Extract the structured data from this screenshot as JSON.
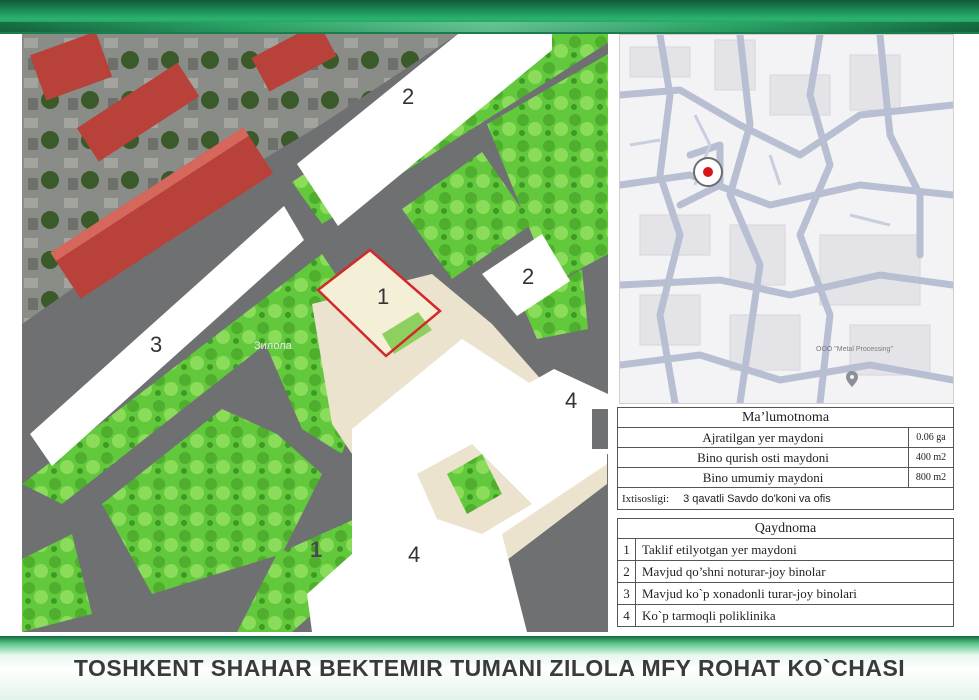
{
  "footer": {
    "title": "TOSHKENT SHAHAR BEKTEMIR TUMANI ZILOLA MFY ROHAT KO`CHASI"
  },
  "site_plan": {
    "labels": {
      "plot": "1",
      "plot_map": "1",
      "bldg_2a": "2",
      "bldg_2b": "2",
      "bldg_3": "3",
      "bldg_4a": "4",
      "bldg_4b": "4",
      "place_name": "Зилола"
    },
    "colors": {
      "road": "#6f7072",
      "greenery": "#5fc83a",
      "plot_outline": "#d22a2a",
      "building": "#ffffff",
      "plaza": "#ece3cf"
    }
  },
  "locator_map": {
    "poi_label": "OOO \"Metal Processing\"",
    "marker_color": "#d7141a"
  },
  "info": {
    "header": "Ma’lumotnoma",
    "rows": [
      {
        "label": "Ajratilgan yer maydoni",
        "value": "0.06 ga"
      },
      {
        "label": "Bino qurish osti maydoni",
        "value": "400 m2"
      },
      {
        "label": "Bino umumiy maydoni",
        "value": "800 m2"
      }
    ],
    "purpose_label": "Ixtisosligi:",
    "purpose_value": "3 qavatli Savdo do'koni va ofis"
  },
  "legend": {
    "header": "Qaydnoma",
    "items": [
      {
        "num": "1",
        "text": "Taklif etilyotgan yer maydoni"
      },
      {
        "num": "2",
        "text": "Mavjud qo’shni noturar-joy binolar"
      },
      {
        "num": "3",
        "text": "Mavjud ko`p xonadonli turar-joy binolari"
      },
      {
        "num": "4",
        "text": "Ko`p tarmoqli poliklinika"
      }
    ]
  }
}
